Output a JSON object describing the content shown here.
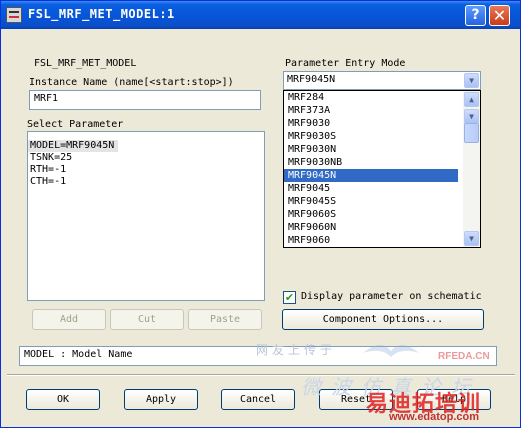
{
  "window": {
    "title": "FSL_MRF_MET_MODEL:1",
    "help_glyph": "?",
    "close_glyph": "✕"
  },
  "model_name": "FSL_MRF_MET_MODEL",
  "instance": {
    "label": "Instance Name  (name[<start:stop>])",
    "value": "MRF1"
  },
  "select_parameter": {
    "label": "Select Parameter",
    "items": [
      "MODEL=MRF9045N",
      "TSNK=25",
      "RTH=-1",
      "CTH=-1"
    ],
    "selected_index": 0
  },
  "buttons": {
    "add": "Add",
    "cut": "Cut",
    "paste": "Paste",
    "component_options": "Component Options...",
    "ok": "OK",
    "apply": "Apply",
    "cancel": "Cancel",
    "reset": "Reset",
    "help": "Help"
  },
  "entry_mode": {
    "label": "Parameter Entry Mode",
    "value": "MRF9045N",
    "options": [
      "MRF284",
      "MRF373A",
      "MRF9030",
      "MRF9030S",
      "MRF9030N",
      "MRF9030NB",
      "MRF9045N",
      "MRF9045",
      "MRF9045S",
      "MRF9060S",
      "MRF9060N",
      "MRF9060"
    ],
    "highlighted_index": 6
  },
  "display_checkbox": {
    "label": "Display parameter on schematic",
    "checked": true,
    "check_glyph": "✔"
  },
  "description": "MODEL : Model Name",
  "watermark": {
    "line1": "网友上传于",
    "line2": "微波仿真论坛",
    "site1": "RFEDA.CN",
    "brand": "易迪拓培训",
    "site2": "www.edatop.com"
  }
}
